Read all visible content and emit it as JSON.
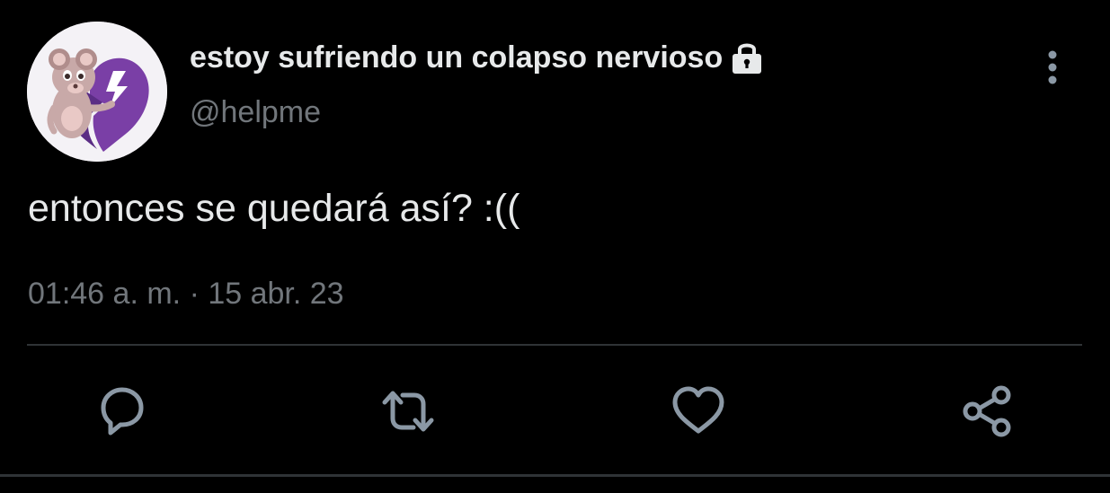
{
  "profile": {
    "display_name": "estoy sufriendo un colapso nervioso",
    "handle": "@helpme",
    "avatar_icon": "avatar-mouse-broken-heart",
    "protected_icon": "lock-icon"
  },
  "tweet": {
    "text": "entonces se quedará así? :((",
    "time": "01:46 a. m.",
    "separator": "·",
    "date": "15 abr. 23"
  },
  "actions": [
    {
      "icon": "reply-icon"
    },
    {
      "icon": "retweet-icon"
    },
    {
      "icon": "like-icon"
    },
    {
      "icon": "share-icon"
    }
  ],
  "menu": {
    "icon": "more-options-icon"
  },
  "colors": {
    "background": "#000000",
    "primary_text": "#e7e9ea",
    "secondary_text": "#71767b",
    "icon": "#8b98a5",
    "divider": "#2f3336",
    "avatar_heart": "#7a3fa6"
  }
}
